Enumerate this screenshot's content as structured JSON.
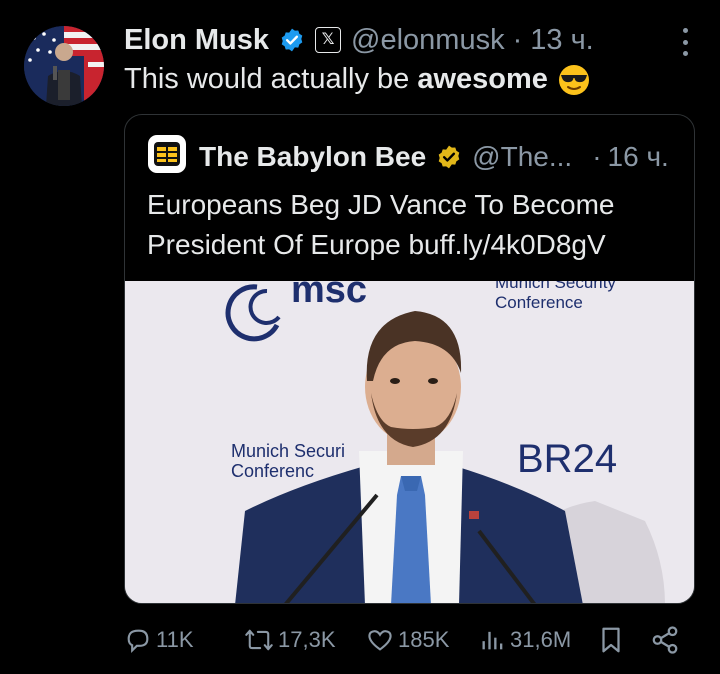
{
  "author": {
    "name": "Elon Musk",
    "handle": "@elonmusk",
    "time": "13 ч.",
    "dot": "·"
  },
  "tweet": {
    "text_plain": "This would actually be",
    "text_bold": "awesome"
  },
  "quote": {
    "name": "The Babylon Bee",
    "handle": "@The...",
    "dot": "·",
    "time": "16 ч.",
    "text": "Europeans Beg JD Vance To Become President Of Europe buff.ly/4k0D8gV",
    "image": {
      "logo_text": "msc",
      "top_right_text_1": "Munich Security",
      "top_right_text_2": "Conference",
      "podium_text_1": "Munich Securi",
      "podium_text_2": "Conferenc",
      "br24": "BR24"
    }
  },
  "actions": {
    "replies": "11K",
    "reposts": "17,3K",
    "likes": "185K",
    "views": "31,6M"
  },
  "colors": {
    "verified": "#1d9bf0",
    "gold": "#e2b719",
    "muted": "#8b98a5",
    "border": "#2f3336"
  },
  "icons": [
    "verified-badge-icon",
    "x-affiliate-icon",
    "more-icon",
    "reply-icon",
    "repost-icon",
    "like-icon",
    "views-icon",
    "bookmark-icon",
    "share-icon"
  ]
}
